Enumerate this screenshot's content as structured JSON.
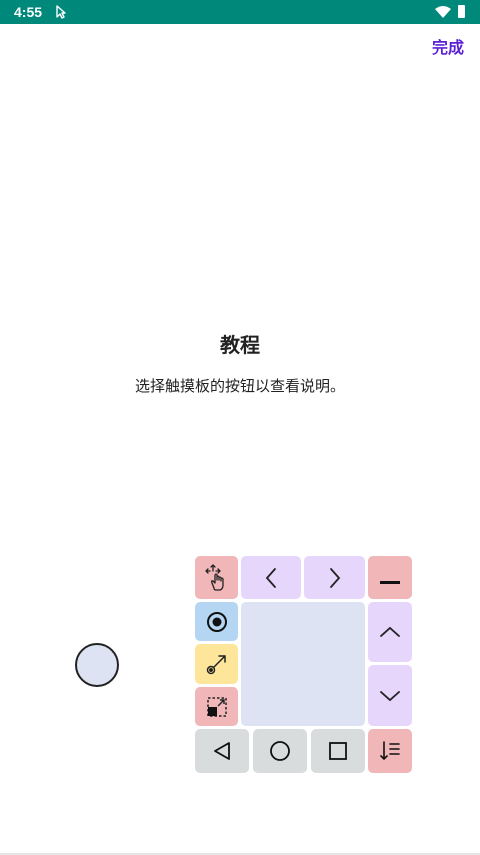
{
  "status_bar": {
    "time": "4:55",
    "icons": [
      "cursor-icon",
      "wifi-icon",
      "battery-icon"
    ],
    "background": "#00897b"
  },
  "header": {
    "done_label": "完成",
    "accent_color": "#5b1fd6"
  },
  "tutorial": {
    "title": "教程",
    "description": "选择触摸板的按钮以查看说明。"
  },
  "touchpad": {
    "buttons": [
      {
        "name": "move-touchpad-button",
        "icon": "drag-hand-icon",
        "color": "#f0b6b8"
      },
      {
        "name": "left-arrow-button",
        "icon": "chevron-left-icon",
        "color": "#e6d6fb"
      },
      {
        "name": "right-arrow-button",
        "icon": "chevron-right-icon",
        "color": "#e6d6fb"
      },
      {
        "name": "minimize-button",
        "icon": "minus-icon",
        "color": "#f0b6b8"
      },
      {
        "name": "click-mode-button",
        "icon": "radio-dot-icon",
        "color": "#b5d6f3"
      },
      {
        "name": "drag-mode-button",
        "icon": "drag-arrow-icon",
        "color": "#fde69a"
      },
      {
        "name": "select-mode-button",
        "icon": "selection-icon",
        "color": "#f0b6b8"
      },
      {
        "name": "scroll-up-button",
        "icon": "chevron-up-icon",
        "color": "#e6d6fb"
      },
      {
        "name": "scroll-down-button",
        "icon": "chevron-down-icon",
        "color": "#e6d6fb"
      },
      {
        "name": "back-button",
        "icon": "triangle-back-icon",
        "color": "#d8dcdc"
      },
      {
        "name": "home-button",
        "icon": "circle-home-icon",
        "color": "#d8dcdc"
      },
      {
        "name": "recents-button",
        "icon": "square-recents-icon",
        "color": "#d8dcdc"
      },
      {
        "name": "menu-button",
        "icon": "sort-list-icon",
        "color": "#f0b6b8"
      }
    ],
    "pad_color": "#dde3f2"
  }
}
